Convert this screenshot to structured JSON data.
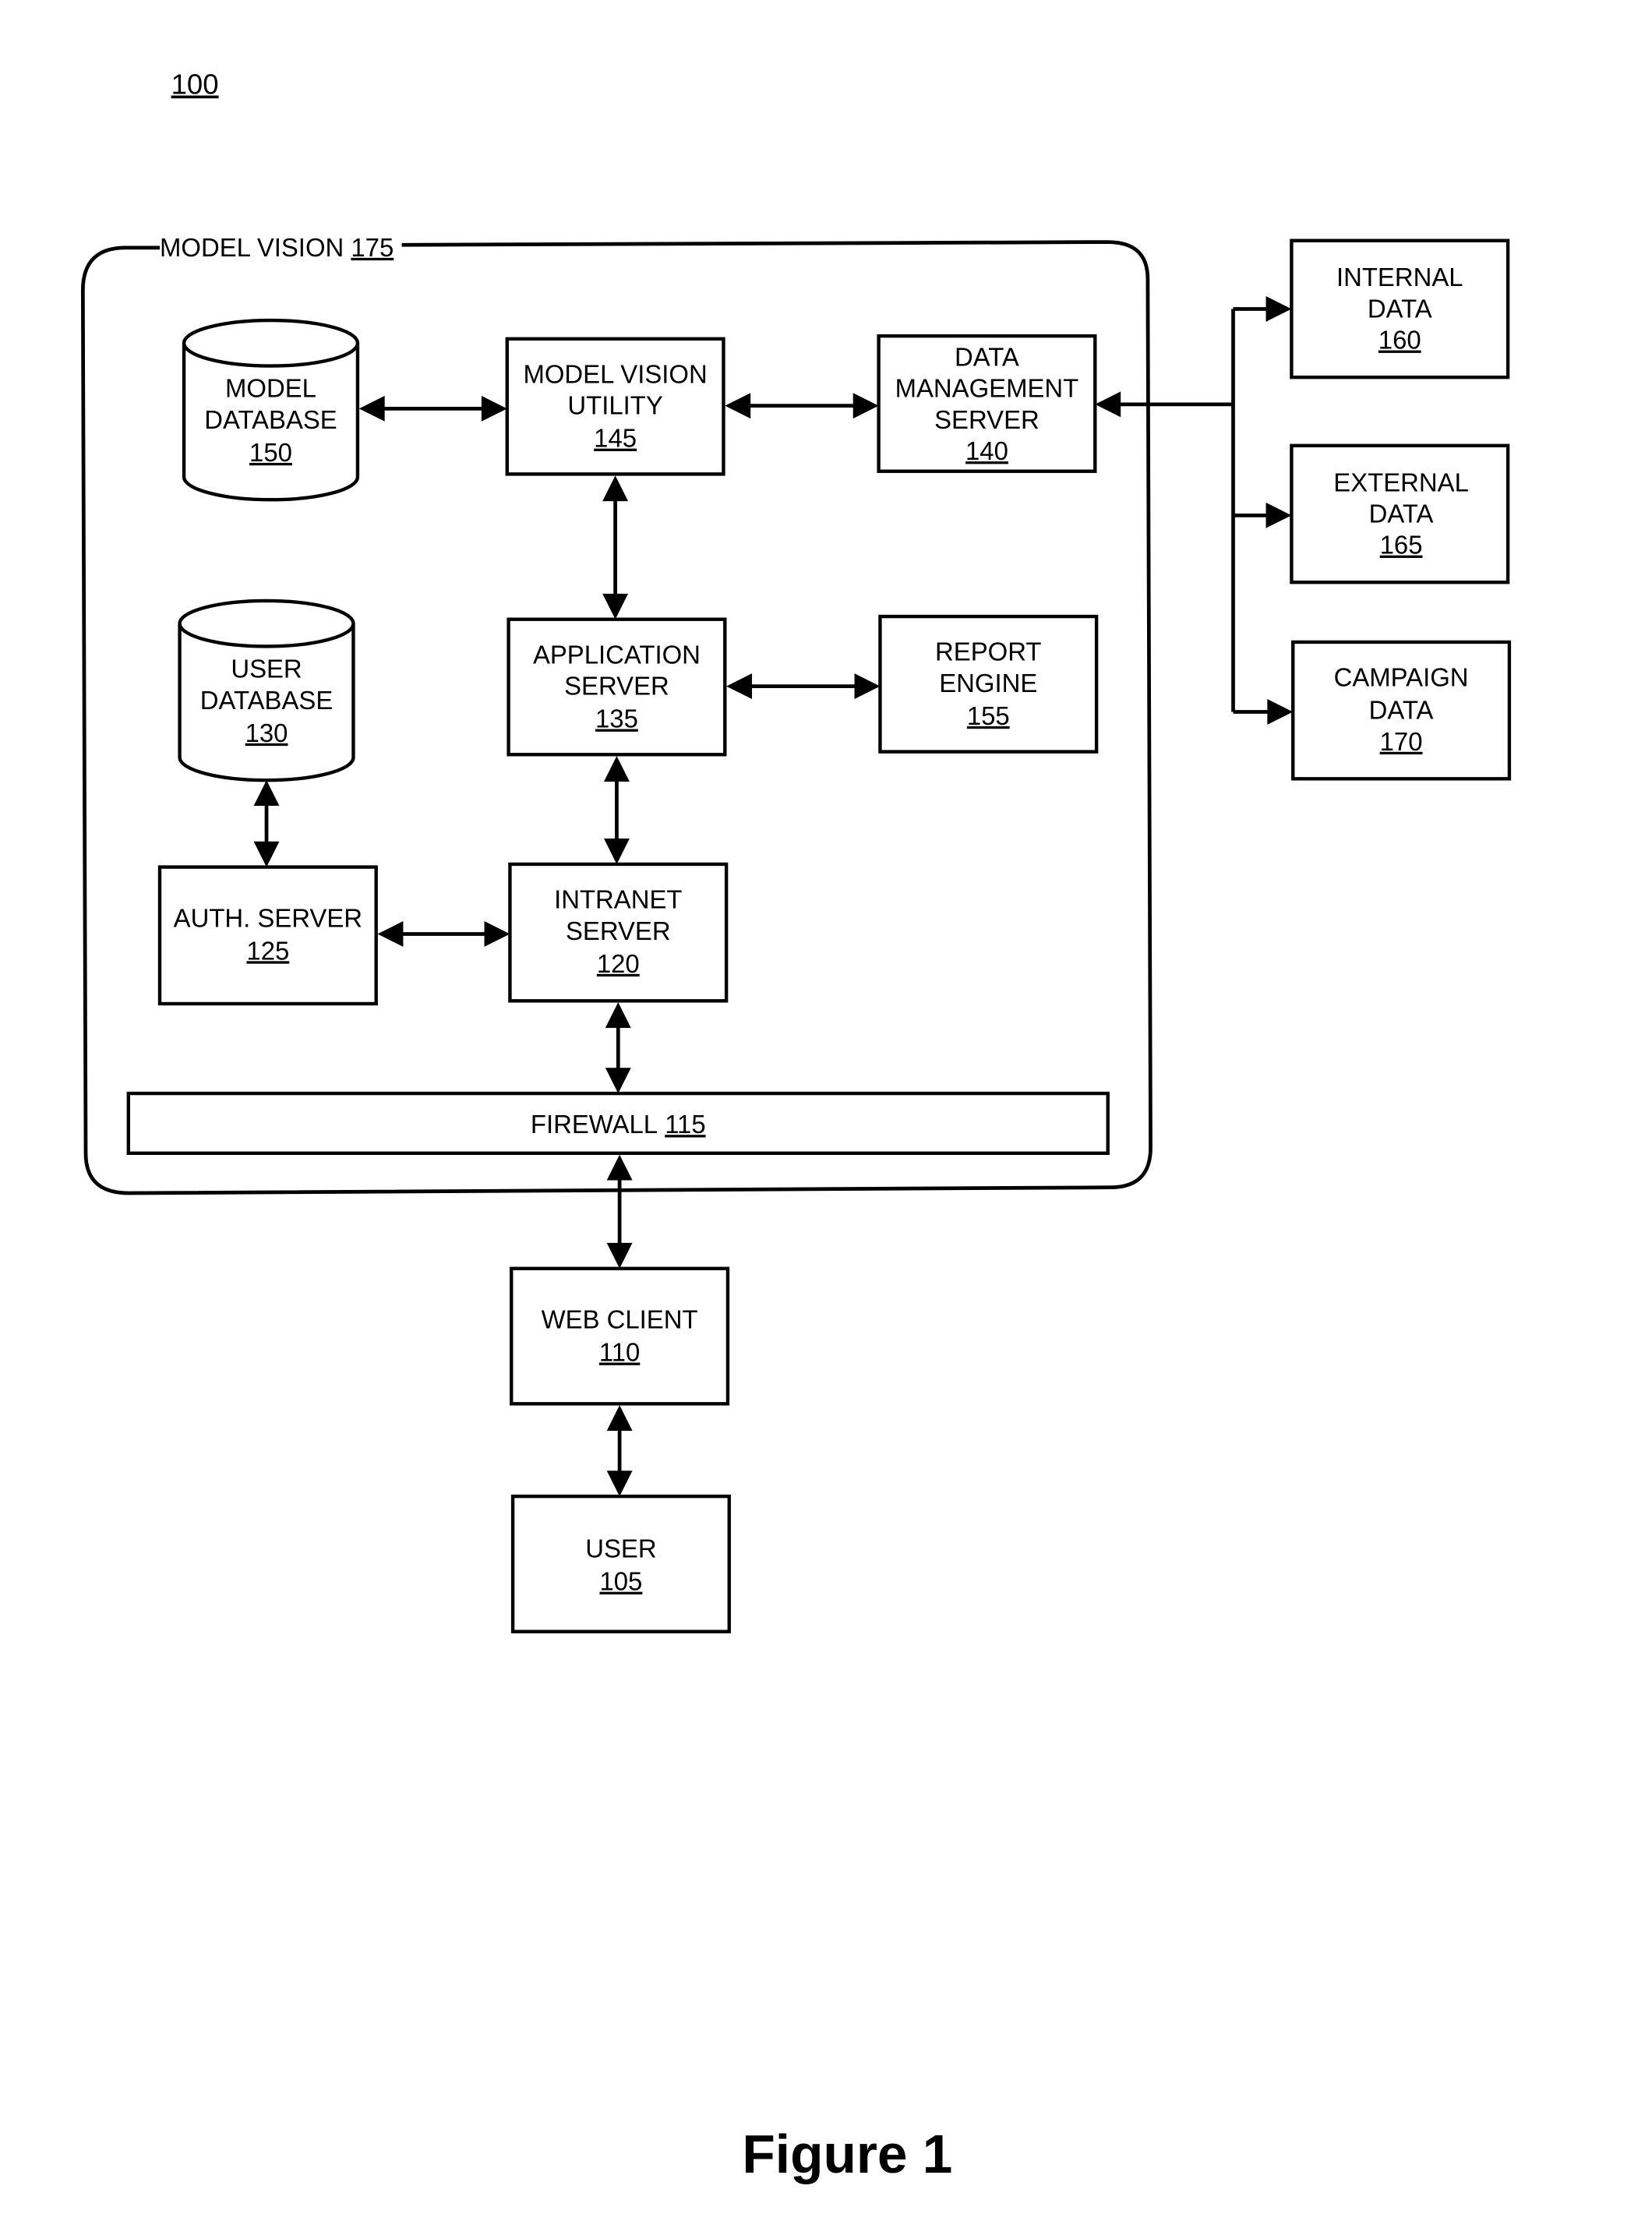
{
  "figure_ref": "100",
  "figure_caption": "Figure 1",
  "container": {
    "label": "MODEL VISION",
    "ref": "175"
  },
  "nodes": {
    "model_database": {
      "lines": [
        "MODEL",
        "DATABASE"
      ],
      "ref": "150",
      "shape": "cylinder"
    },
    "model_vision_utility": {
      "lines": [
        "MODEL VISION",
        "UTILITY"
      ],
      "ref": "145",
      "shape": "box"
    },
    "data_management_server": {
      "lines": [
        "DATA",
        "MANAGEMENT",
        "SERVER"
      ],
      "ref": "140",
      "shape": "box"
    },
    "user_database": {
      "lines": [
        "USER",
        "DATABASE"
      ],
      "ref": "130",
      "shape": "cylinder"
    },
    "application_server": {
      "lines": [
        "APPLICATION",
        "SERVER"
      ],
      "ref": "135",
      "shape": "box"
    },
    "report_engine": {
      "lines": [
        "REPORT",
        "ENGINE"
      ],
      "ref": "155",
      "shape": "box"
    },
    "auth_server": {
      "lines": [
        "AUTH. SERVER"
      ],
      "ref": "125",
      "shape": "box"
    },
    "intranet_server": {
      "lines": [
        "INTRANET",
        "SERVER"
      ],
      "ref": "120",
      "shape": "box"
    },
    "firewall": {
      "lines": [
        "FIREWALL"
      ],
      "ref": "115",
      "shape": "bar"
    },
    "web_client": {
      "lines": [
        "WEB CLIENT"
      ],
      "ref": "110",
      "shape": "box"
    },
    "user": {
      "lines": [
        "USER"
      ],
      "ref": "105",
      "shape": "box"
    },
    "internal_data": {
      "lines": [
        "INTERNAL",
        "DATA"
      ],
      "ref": "160",
      "shape": "box"
    },
    "external_data": {
      "lines": [
        "EXTERNAL",
        "DATA"
      ],
      "ref": "165",
      "shape": "box"
    },
    "campaign_data": {
      "lines": [
        "CAMPAIGN",
        "DATA"
      ],
      "ref": "170",
      "shape": "box"
    }
  },
  "connections": [
    {
      "from": "model_database",
      "to": "model_vision_utility",
      "direction": "both"
    },
    {
      "from": "model_vision_utility",
      "to": "data_management_server",
      "direction": "both"
    },
    {
      "from": "model_vision_utility",
      "to": "application_server",
      "direction": "both"
    },
    {
      "from": "application_server",
      "to": "report_engine",
      "direction": "both"
    },
    {
      "from": "application_server",
      "to": "intranet_server",
      "direction": "both"
    },
    {
      "from": "user_database",
      "to": "auth_server",
      "direction": "both"
    },
    {
      "from": "auth_server",
      "to": "intranet_server",
      "direction": "both"
    },
    {
      "from": "intranet_server",
      "to": "firewall",
      "direction": "both"
    },
    {
      "from": "firewall",
      "to": "web_client",
      "direction": "both"
    },
    {
      "from": "web_client",
      "to": "user",
      "direction": "both"
    },
    {
      "from": "internal_data",
      "to": "data_management_server",
      "direction": "to"
    },
    {
      "from": "data_management_server",
      "to": "internal_data",
      "direction": "to"
    },
    {
      "from": "data_management_server",
      "to": "external_data",
      "direction": "to"
    },
    {
      "from": "data_management_server",
      "to": "campaign_data",
      "direction": "to"
    }
  ]
}
